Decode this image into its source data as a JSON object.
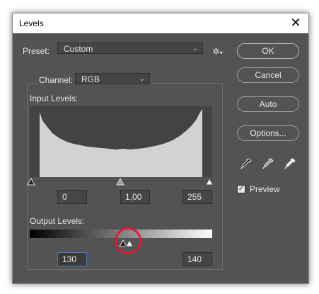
{
  "window": {
    "title": "Levels",
    "close_glyph": "✕"
  },
  "preset": {
    "label": "Preset:",
    "value": "Custom"
  },
  "channel": {
    "label": "Channel:",
    "value": "RGB"
  },
  "input_levels": {
    "label": "Input Levels:",
    "black": "0",
    "gamma": "1,00",
    "white": "255"
  },
  "output_levels": {
    "label": "Output Levels:",
    "black": "130",
    "white": "140"
  },
  "buttons": {
    "ok": "OK",
    "cancel": "Cancel",
    "auto": "Auto",
    "options": "Options..."
  },
  "preview": {
    "label": "Preview",
    "checked": true
  },
  "icons": [
    "gear-icon",
    "eyedropper-black-icon",
    "eyedropper-gray-icon",
    "eyedropper-white-icon",
    "chevron-down-icon",
    "close-icon"
  ],
  "colors": {
    "dialog_bg": "#535353",
    "field_bg": "#464646",
    "highlight": "#e01a33"
  }
}
